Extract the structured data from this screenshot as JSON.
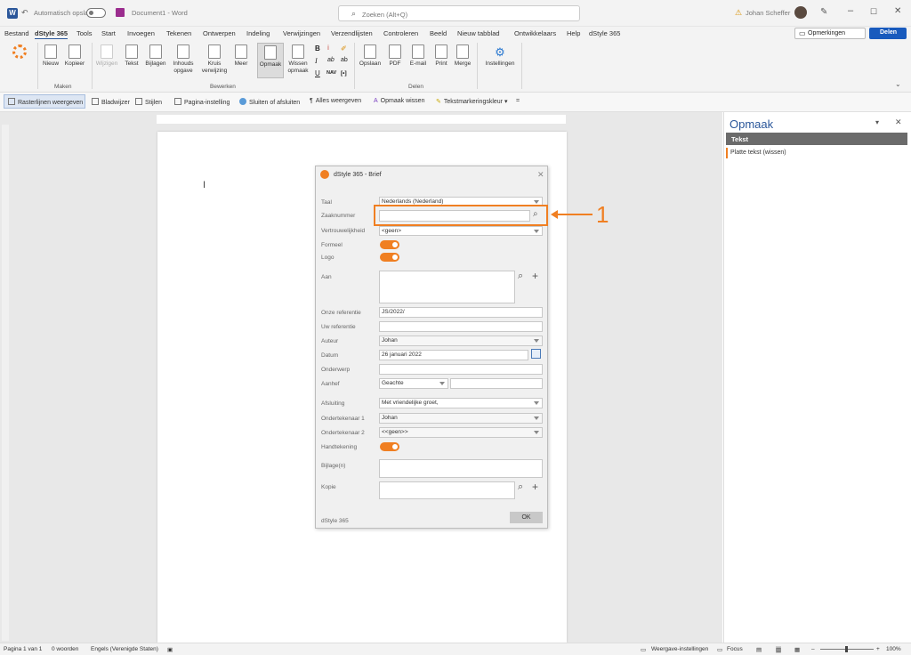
{
  "titlebar": {
    "autosave_label": "Automatisch opslaan",
    "doc_title": "Document1 - Word",
    "search_placeholder": "Zoeken (Alt+Q)",
    "user": "Johan Scheffer"
  },
  "tabs": [
    "Bestand",
    "dStyle 365",
    "Tools",
    "Start",
    "Invoegen",
    "Tekenen",
    "Ontwerpen",
    "Indeling",
    "Verwijzingen",
    "Verzendlijsten",
    "Controleren",
    "Beeld",
    "Nieuw tabblad",
    "Ontwikkelaars",
    "Help",
    "dStyle 365"
  ],
  "tabs_right": {
    "comments": "Opmerkingen",
    "share": "Delen"
  },
  "ribbon": {
    "maken": {
      "nieuw": "Nieuw",
      "kopieer": "Kopieer",
      "label": "Maken"
    },
    "bewerken": {
      "wijzigen": "Wijzigen",
      "tekst": "Tekst",
      "bijlagen": "Bijlagen",
      "inhoud1": "Inhouds",
      "inhoud2": "opgave",
      "kruis1": "Kruis",
      "kruis2": "verwijzing",
      "meer": "Meer",
      "opmaak": "Opmaak",
      "wissen1": "Wissen",
      "wissen2": "opmaak",
      "label": "Bewerken"
    },
    "fmt": {
      "b": "B",
      "i": "I",
      "u": "U",
      "ab": "ab",
      "nav": "NAV",
      "bracket": "[•]"
    },
    "delen": {
      "opslaan": "Opslaan",
      "pdf": "PDF",
      "email": "E-mail",
      "print": "Print",
      "merge": "Merge",
      "label": "Delen"
    },
    "instellingen": "Instellingen"
  },
  "quicktoolbar": [
    "Rasterlijnen weergeven",
    "Bladwijzer",
    "Stijlen",
    "Pagina-instelling",
    "Sluiten of afsluiten",
    "Alles weergeven",
    "Opmaak wissen",
    "Tekstmarkeringskleur"
  ],
  "pane": {
    "title": "Opmaak",
    "header": "Tekst",
    "item": "Platte tekst (wissen)"
  },
  "dialog": {
    "title": "dStyle 365 - Brief",
    "labels": {
      "taal": "Taal",
      "zaaknummer": "Zaaknummer",
      "vertrouwelijkheid": "Vertrouwelijkheid",
      "formeel": "Formeel",
      "logo": "Logo",
      "aan": "Aan",
      "onze_ref": "Onze referentie",
      "uw_ref": "Uw referentie",
      "auteur": "Auteur",
      "datum": "Datum",
      "onderwerp": "Onderwerp",
      "aanhef": "Aanhef",
      "afsluiting": "Afsluiting",
      "ondertekenaar1": "Ondertekenaar 1",
      "ondertekenaar2": "Ondertekenaar 2",
      "handtekening": "Handtekening",
      "bijlage": "Bijlage(n)",
      "kopie": "Kopie"
    },
    "values": {
      "taal": "Nederlands (Nederland)",
      "vertrouwelijkheid": "<geen>",
      "onze_ref": "JS/2022/",
      "auteur": "Johan",
      "datum": "26 januari 2022",
      "aanhef": "Geachte",
      "afsluiting": "Met vriendelijke groet,",
      "ondertekenaar1": "Johan",
      "ondertekenaar2": "<<geen>>"
    },
    "footer": "dStyle 365",
    "ok": "OK"
  },
  "callout": {
    "number": "1",
    "color": "#f07f22"
  },
  "status": {
    "page": "Pagina 1 van 1",
    "words": "0 woorden",
    "lang": "Engels (Verenigde Staten)",
    "display": "Weergave-instellingen",
    "focus": "Focus",
    "zoom": "100%"
  },
  "colors": {
    "accent": "#f07f22",
    "word_blue": "#2b579a",
    "share_blue": "#185abd"
  }
}
